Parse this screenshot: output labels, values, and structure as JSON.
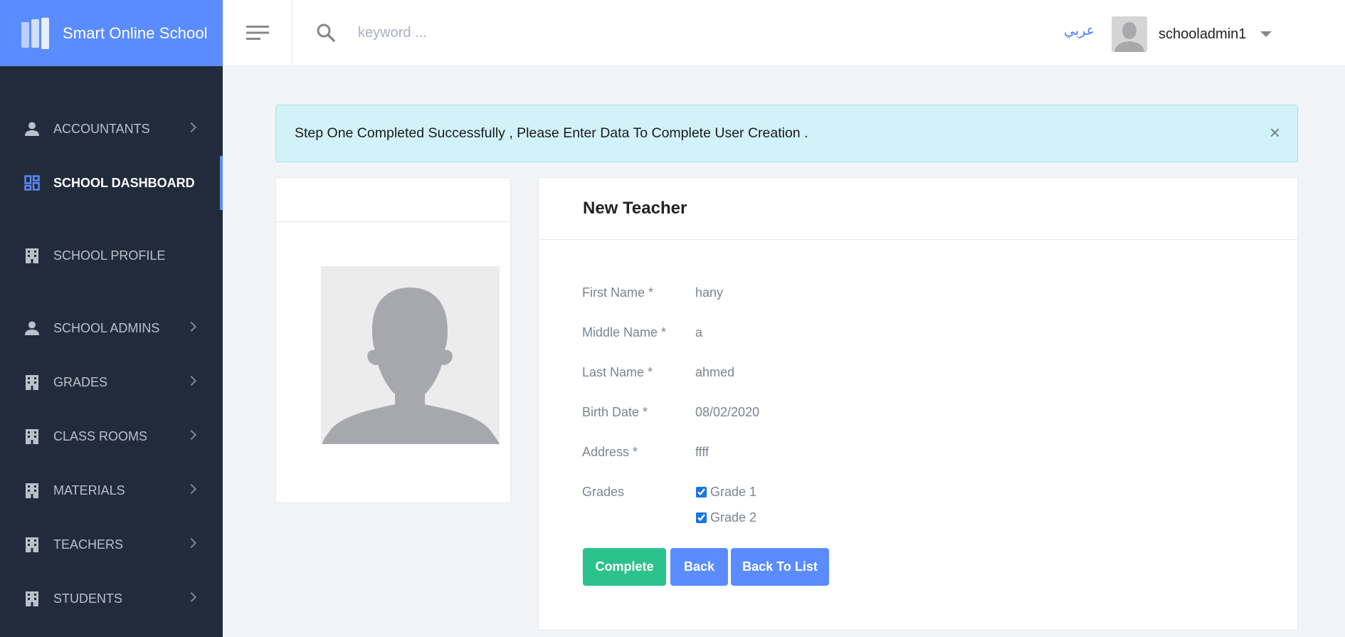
{
  "brand": {
    "title": "Smart Online School"
  },
  "header": {
    "search_placeholder": "keyword ...",
    "language_link": "عربي",
    "username": "schooladmin1"
  },
  "sidebar": {
    "items": [
      {
        "label": "ACCOUNTANTS",
        "icon": "person-icon",
        "has_submenu": true
      },
      {
        "label": "SCHOOL DASHBOARD",
        "icon": "dashboard-icon",
        "has_submenu": false,
        "active": true
      },
      {
        "label": "SCHOOL PROFILE",
        "icon": "building-icon",
        "has_submenu": false
      },
      {
        "label": "SCHOOL ADMINS",
        "icon": "person-icon",
        "has_submenu": true
      },
      {
        "label": "GRADES",
        "icon": "building-icon",
        "has_submenu": true
      },
      {
        "label": "CLASS ROOMS",
        "icon": "building-icon",
        "has_submenu": true
      },
      {
        "label": "MATERIALS",
        "icon": "building-icon",
        "has_submenu": true
      },
      {
        "label": "TEACHERS",
        "icon": "building-icon",
        "has_submenu": true
      },
      {
        "label": "STUDENTS",
        "icon": "building-icon",
        "has_submenu": true
      }
    ]
  },
  "alert": {
    "message": "Step One Completed Successfully , Please Enter Data To Complete User Creation .",
    "close_symbol": "×"
  },
  "form": {
    "title": "New Teacher",
    "fields": [
      {
        "label": "First Name *",
        "value": "hany"
      },
      {
        "label": "Middle Name *",
        "value": "a"
      },
      {
        "label": "Last Name *",
        "value": "ahmed"
      },
      {
        "label": "Birth Date *",
        "value": "08/02/2020"
      },
      {
        "label": "Address *",
        "value": "ffff"
      }
    ],
    "grades_label": "Grades",
    "grades": [
      {
        "label": "Grade 1",
        "checked": true
      },
      {
        "label": "Grade 2",
        "checked": true
      }
    ],
    "buttons": {
      "complete": "Complete",
      "back": "Back",
      "back_to_list": "Back To List"
    }
  },
  "colors": {
    "brand_blue": "#5b8cff",
    "sidebar_bg": "#222b3b",
    "success_green": "#2bc28d",
    "alert_bg": "#d1f2f8"
  }
}
